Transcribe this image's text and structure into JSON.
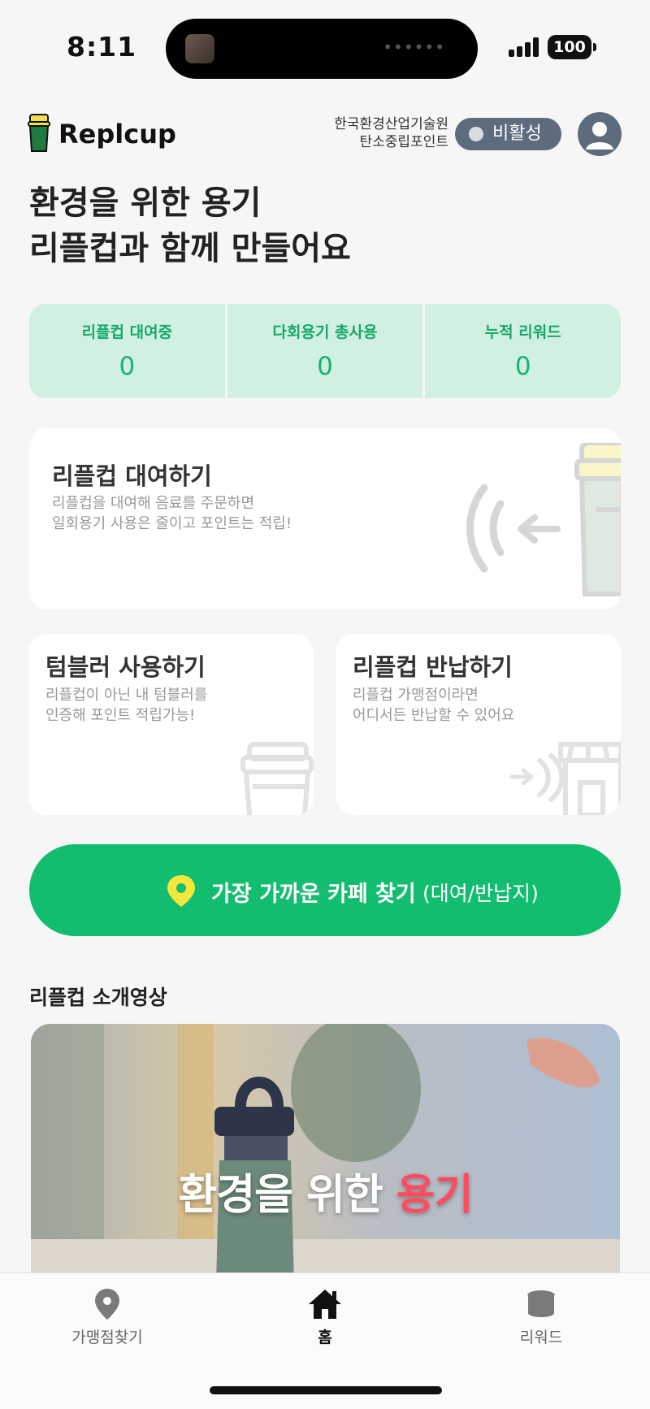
{
  "status_bar": {
    "time": "8:11",
    "battery": "100"
  },
  "header": {
    "logo_text": "Replcup",
    "org_line1": "한국환경산업기술원",
    "org_line2": "탄소중립포인트",
    "toggle_label": "비활성"
  },
  "headline": {
    "line1": "환경을 위한 용기",
    "line2": "리플컵과 함께 만들어요"
  },
  "stats": [
    {
      "label": "리플컵 대여중",
      "value": "0"
    },
    {
      "label": "다회용기 총사용",
      "value": "0"
    },
    {
      "label": "누적 리워드",
      "value": "0"
    }
  ],
  "cards": {
    "rent": {
      "title": "리플컵 대여하기",
      "desc1": "리플컵을 대여해 음료를 주문하면",
      "desc2": "일회용기 사용은 줄이고 포인트는 적립!"
    },
    "tumbler": {
      "title": "텀블러 사용하기",
      "desc1": "리플컵이 아닌 내 텀블러를",
      "desc2": "인증해 포인트 적립가능!"
    },
    "return": {
      "title": "리플컵 반납하기",
      "desc1": "리플컵 가맹점이라면",
      "desc2": "어디서든 반납할 수 있어요"
    }
  },
  "find_button": {
    "label": "가장 가까운 카페 찾기",
    "sub": "(대여/반납지)"
  },
  "video_section": {
    "title": "리플컵 소개영상",
    "caption_main": "환경을 위한 ",
    "caption_accent": "용기"
  },
  "bottom_nav": [
    {
      "label": "가맹점찾기",
      "icon": "map-pin-icon"
    },
    {
      "label": "홈",
      "icon": "home-icon"
    },
    {
      "label": "리워드",
      "icon": "coins-icon"
    }
  ],
  "colors": {
    "brand_green": "#12bd6f",
    "stat_bg": "#d1f0e2",
    "toggle_bg": "#5d6b7d",
    "accent_red": "#ff4d5e"
  }
}
